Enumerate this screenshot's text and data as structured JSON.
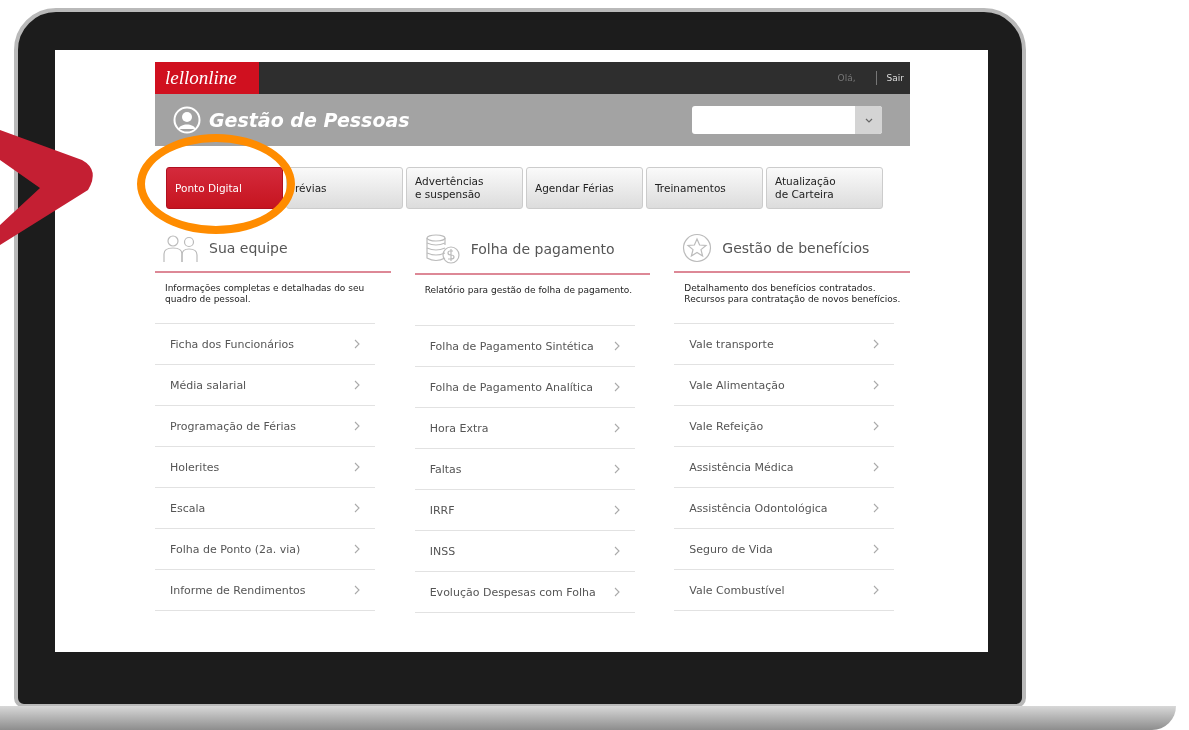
{
  "top_bar": {
    "logo": "lellonline",
    "greeting": "Olá,",
    "logout": "Sair"
  },
  "header": {
    "title": "Gestão de Pessoas"
  },
  "tabs": [
    {
      "label": "Ponto Digital",
      "selected": true
    },
    {
      "label": "révias",
      "selected": false
    },
    {
      "label": "Advertências\ne suspensão",
      "selected": false
    },
    {
      "label": "Agendar Férias",
      "selected": false
    },
    {
      "label": "Treinamentos",
      "selected": false
    },
    {
      "label": "Atualização\nde Carteira",
      "selected": false
    }
  ],
  "sections": [
    {
      "kind": "team",
      "title": "Sua equipe",
      "description": "Informações completas e detalhadas do seu quadro de pessoal.",
      "items": [
        "Ficha dos Funcionários",
        "Média salarial",
        "Programação de Férias",
        "Holerites",
        "Escala",
        "Folha de Ponto (2a. via)",
        "Informe de Rendimentos"
      ]
    },
    {
      "kind": "payroll",
      "title": "Folha de pagamento",
      "description": "Relatório para gestão de folha de pagamento.",
      "items": [
        "Folha de Pagamento Sintética",
        "Folha de Pagamento Analítica",
        "Hora Extra",
        "Faltas",
        "IRRF",
        "INSS",
        "Evolução Despesas com Folha"
      ]
    },
    {
      "kind": "benefits",
      "title": "Gestão de benefícios",
      "description": "Detalhamento dos benefícios contratados.\nRecursos para contratação de novos benefícios.",
      "items": [
        "Vale transporte",
        "Vale Alimentação",
        "Vale Refeição",
        "Assistência Médica",
        "Assistência Odontológica",
        "Seguro de Vida",
        "Vale Combustível"
      ]
    }
  ]
}
